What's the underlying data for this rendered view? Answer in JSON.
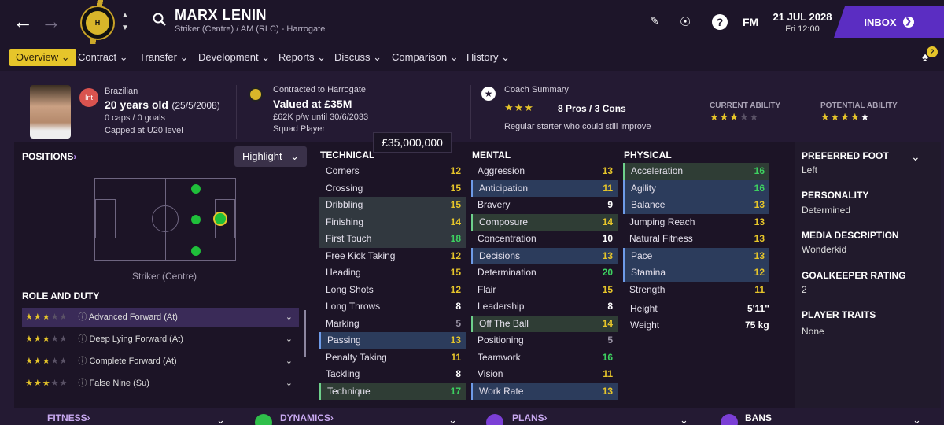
{
  "header": {
    "player_name": "MARX LENIN",
    "subtitle": "Striker (Centre) / AM (RLC) - Harrogate",
    "fm": "FM",
    "date": "21 JUL 2028",
    "time": "Fri 12:00",
    "inbox": "INBOX",
    "notif_count": "2"
  },
  "tabs": [
    {
      "label": "Overview"
    },
    {
      "label": "Contract"
    },
    {
      "label": "Transfer"
    },
    {
      "label": "Development"
    },
    {
      "label": "Reports"
    },
    {
      "label": "Discuss"
    },
    {
      "label": "Comparison"
    },
    {
      "label": "History"
    }
  ],
  "info": {
    "nationality": "Brazilian",
    "int_badge": "Int",
    "age": "20 years old",
    "dob": "(25/5/2008)",
    "caps": "0 caps / 0 goals",
    "capped": "Capped at U20 level",
    "contract_title": "Contracted to Harrogate",
    "valued": "Valued at £35M",
    "wage": "£62K p/w until 30/6/2033",
    "squad_status": "Squad Player",
    "coach_title": "Coach Summary",
    "pros_cons": "8 Pros / 3 Cons",
    "coach_desc": "Regular starter who could still improve",
    "current_ability_label": "CURRENT ABILITY",
    "potential_ability_label": "POTENTIAL ABILITY",
    "coach_stars": 3,
    "current_ability_stars": 3,
    "potential_ability_stars": 4.5
  },
  "positions": {
    "title": "POSITIONS",
    "highlight": "Highlight",
    "position_label": "Striker (Centre)",
    "role_title": "ROLE AND DUTY",
    "roles": [
      {
        "name": "Advanced Forward (At)",
        "stars": 3
      },
      {
        "name": "Deep Lying Forward (At)",
        "stars": 3
      },
      {
        "name": "Complete Forward (At)",
        "stars": 3
      },
      {
        "name": "False Nine (Su)",
        "stars": 3
      }
    ]
  },
  "tooltip": "£35,000,000",
  "attributes": {
    "technical_title": "TECHNICAL",
    "technical": [
      {
        "n": "Corners",
        "v": "12"
      },
      {
        "n": "Crossing",
        "v": "15"
      },
      {
        "n": "Dribbling",
        "v": "15"
      },
      {
        "n": "Finishing",
        "v": "14"
      },
      {
        "n": "First Touch",
        "v": "18"
      },
      {
        "n": "Free Kick Taking",
        "v": "12"
      },
      {
        "n": "Heading",
        "v": "15"
      },
      {
        "n": "Long Shots",
        "v": "12"
      },
      {
        "n": "Long Throws",
        "v": "8"
      },
      {
        "n": "Marking",
        "v": "5"
      },
      {
        "n": "Passing",
        "v": "13"
      },
      {
        "n": "Penalty Taking",
        "v": "11"
      },
      {
        "n": "Tackling",
        "v": "8"
      },
      {
        "n": "Technique",
        "v": "17"
      }
    ],
    "mental_title": "MENTAL",
    "mental": [
      {
        "n": "Aggression",
        "v": "13"
      },
      {
        "n": "Anticipation",
        "v": "11"
      },
      {
        "n": "Bravery",
        "v": "9"
      },
      {
        "n": "Composure",
        "v": "14"
      },
      {
        "n": "Concentration",
        "v": "10"
      },
      {
        "n": "Decisions",
        "v": "13"
      },
      {
        "n": "Determination",
        "v": "20"
      },
      {
        "n": "Flair",
        "v": "15"
      },
      {
        "n": "Leadership",
        "v": "8"
      },
      {
        "n": "Off The Ball",
        "v": "14"
      },
      {
        "n": "Positioning",
        "v": "5"
      },
      {
        "n": "Teamwork",
        "v": "16"
      },
      {
        "n": "Vision",
        "v": "11"
      },
      {
        "n": "Work Rate",
        "v": "13"
      }
    ],
    "physical_title": "PHYSICAL",
    "physical": [
      {
        "n": "Acceleration",
        "v": "16"
      },
      {
        "n": "Agility",
        "v": "16"
      },
      {
        "n": "Balance",
        "v": "13"
      },
      {
        "n": "Jumping Reach",
        "v": "13"
      },
      {
        "n": "Natural Fitness",
        "v": "13"
      },
      {
        "n": "Pace",
        "v": "13"
      },
      {
        "n": "Stamina",
        "v": "12"
      },
      {
        "n": "Strength",
        "v": "11"
      }
    ],
    "height_label": "Height",
    "height": "5'11\"",
    "weight_label": "Weight",
    "weight": "75 kg"
  },
  "right": {
    "foot_label": "PREFERRED FOOT",
    "foot": "Left",
    "personality_label": "PERSONALITY",
    "personality": "Determined",
    "media_label": "MEDIA DESCRIPTION",
    "media": "Wonderkid",
    "gk_label": "GOALKEEPER RATING",
    "gk": "2",
    "traits_label": "PLAYER TRAITS",
    "traits": "None"
  },
  "bottom": {
    "fitness": "FITNESS",
    "dynamics": "DYNAMICS",
    "plans": "PLANS",
    "bans": "BANS"
  },
  "colors": {
    "accent": "#e6c52a",
    "inbox": "#5b2dc2",
    "green": "#3dd160",
    "yellow": "#e6c52a",
    "highlight_blue": "#2c3c5c"
  }
}
